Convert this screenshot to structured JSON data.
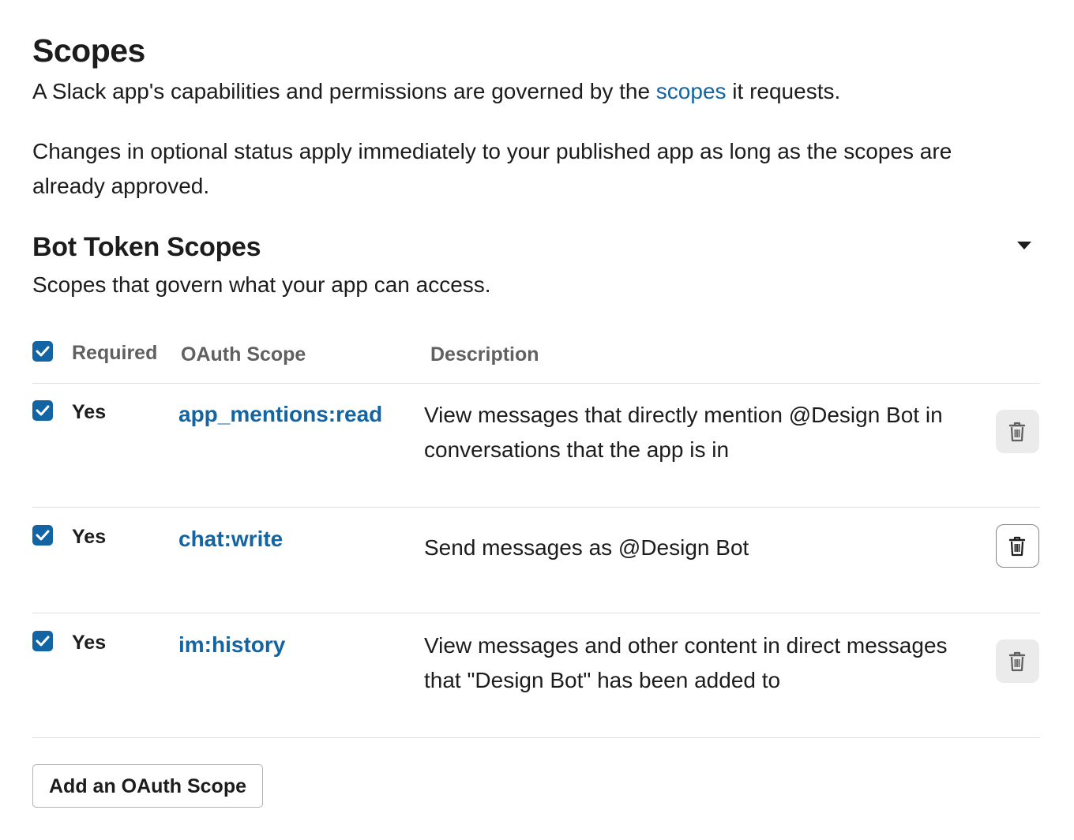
{
  "header": {
    "title": "Scopes",
    "intro_before_link": "A Slack app's capabilities and permissions are governed by the ",
    "intro_link": "scopes",
    "intro_after_link": " it requests.",
    "notice": "Changes in optional status apply immediately to your published app as long as the scopes are already approved."
  },
  "bot_scopes": {
    "title": "Bot Token Scopes",
    "subtitle": "Scopes that govern what your app can access.",
    "columns": {
      "required": "Required",
      "oauth_scope": "OAuth Scope",
      "description": "Description"
    },
    "header_checked": true,
    "rows": [
      {
        "checked": true,
        "required": "Yes",
        "scope": "app_mentions:read",
        "description": "View messages that directly mention @Design Bot in conversations that the app is in"
      },
      {
        "checked": true,
        "required": "Yes",
        "scope": "chat:write",
        "description": "Send messages as @Design Bot"
      },
      {
        "checked": true,
        "required": "Yes",
        "scope": "im:history",
        "description": "View messages and other content in direct messages that \"Design Bot\" has been added to"
      }
    ],
    "add_button": "Add an OAuth Scope"
  },
  "icons": {
    "collapse": "caret-down-icon",
    "delete": "trash-icon",
    "checkbox": "checkmark-icon"
  },
  "colors": {
    "link": "#1264a3",
    "checkbox": "#1264a3",
    "text": "#1d1c1d",
    "muted": "#616061"
  }
}
